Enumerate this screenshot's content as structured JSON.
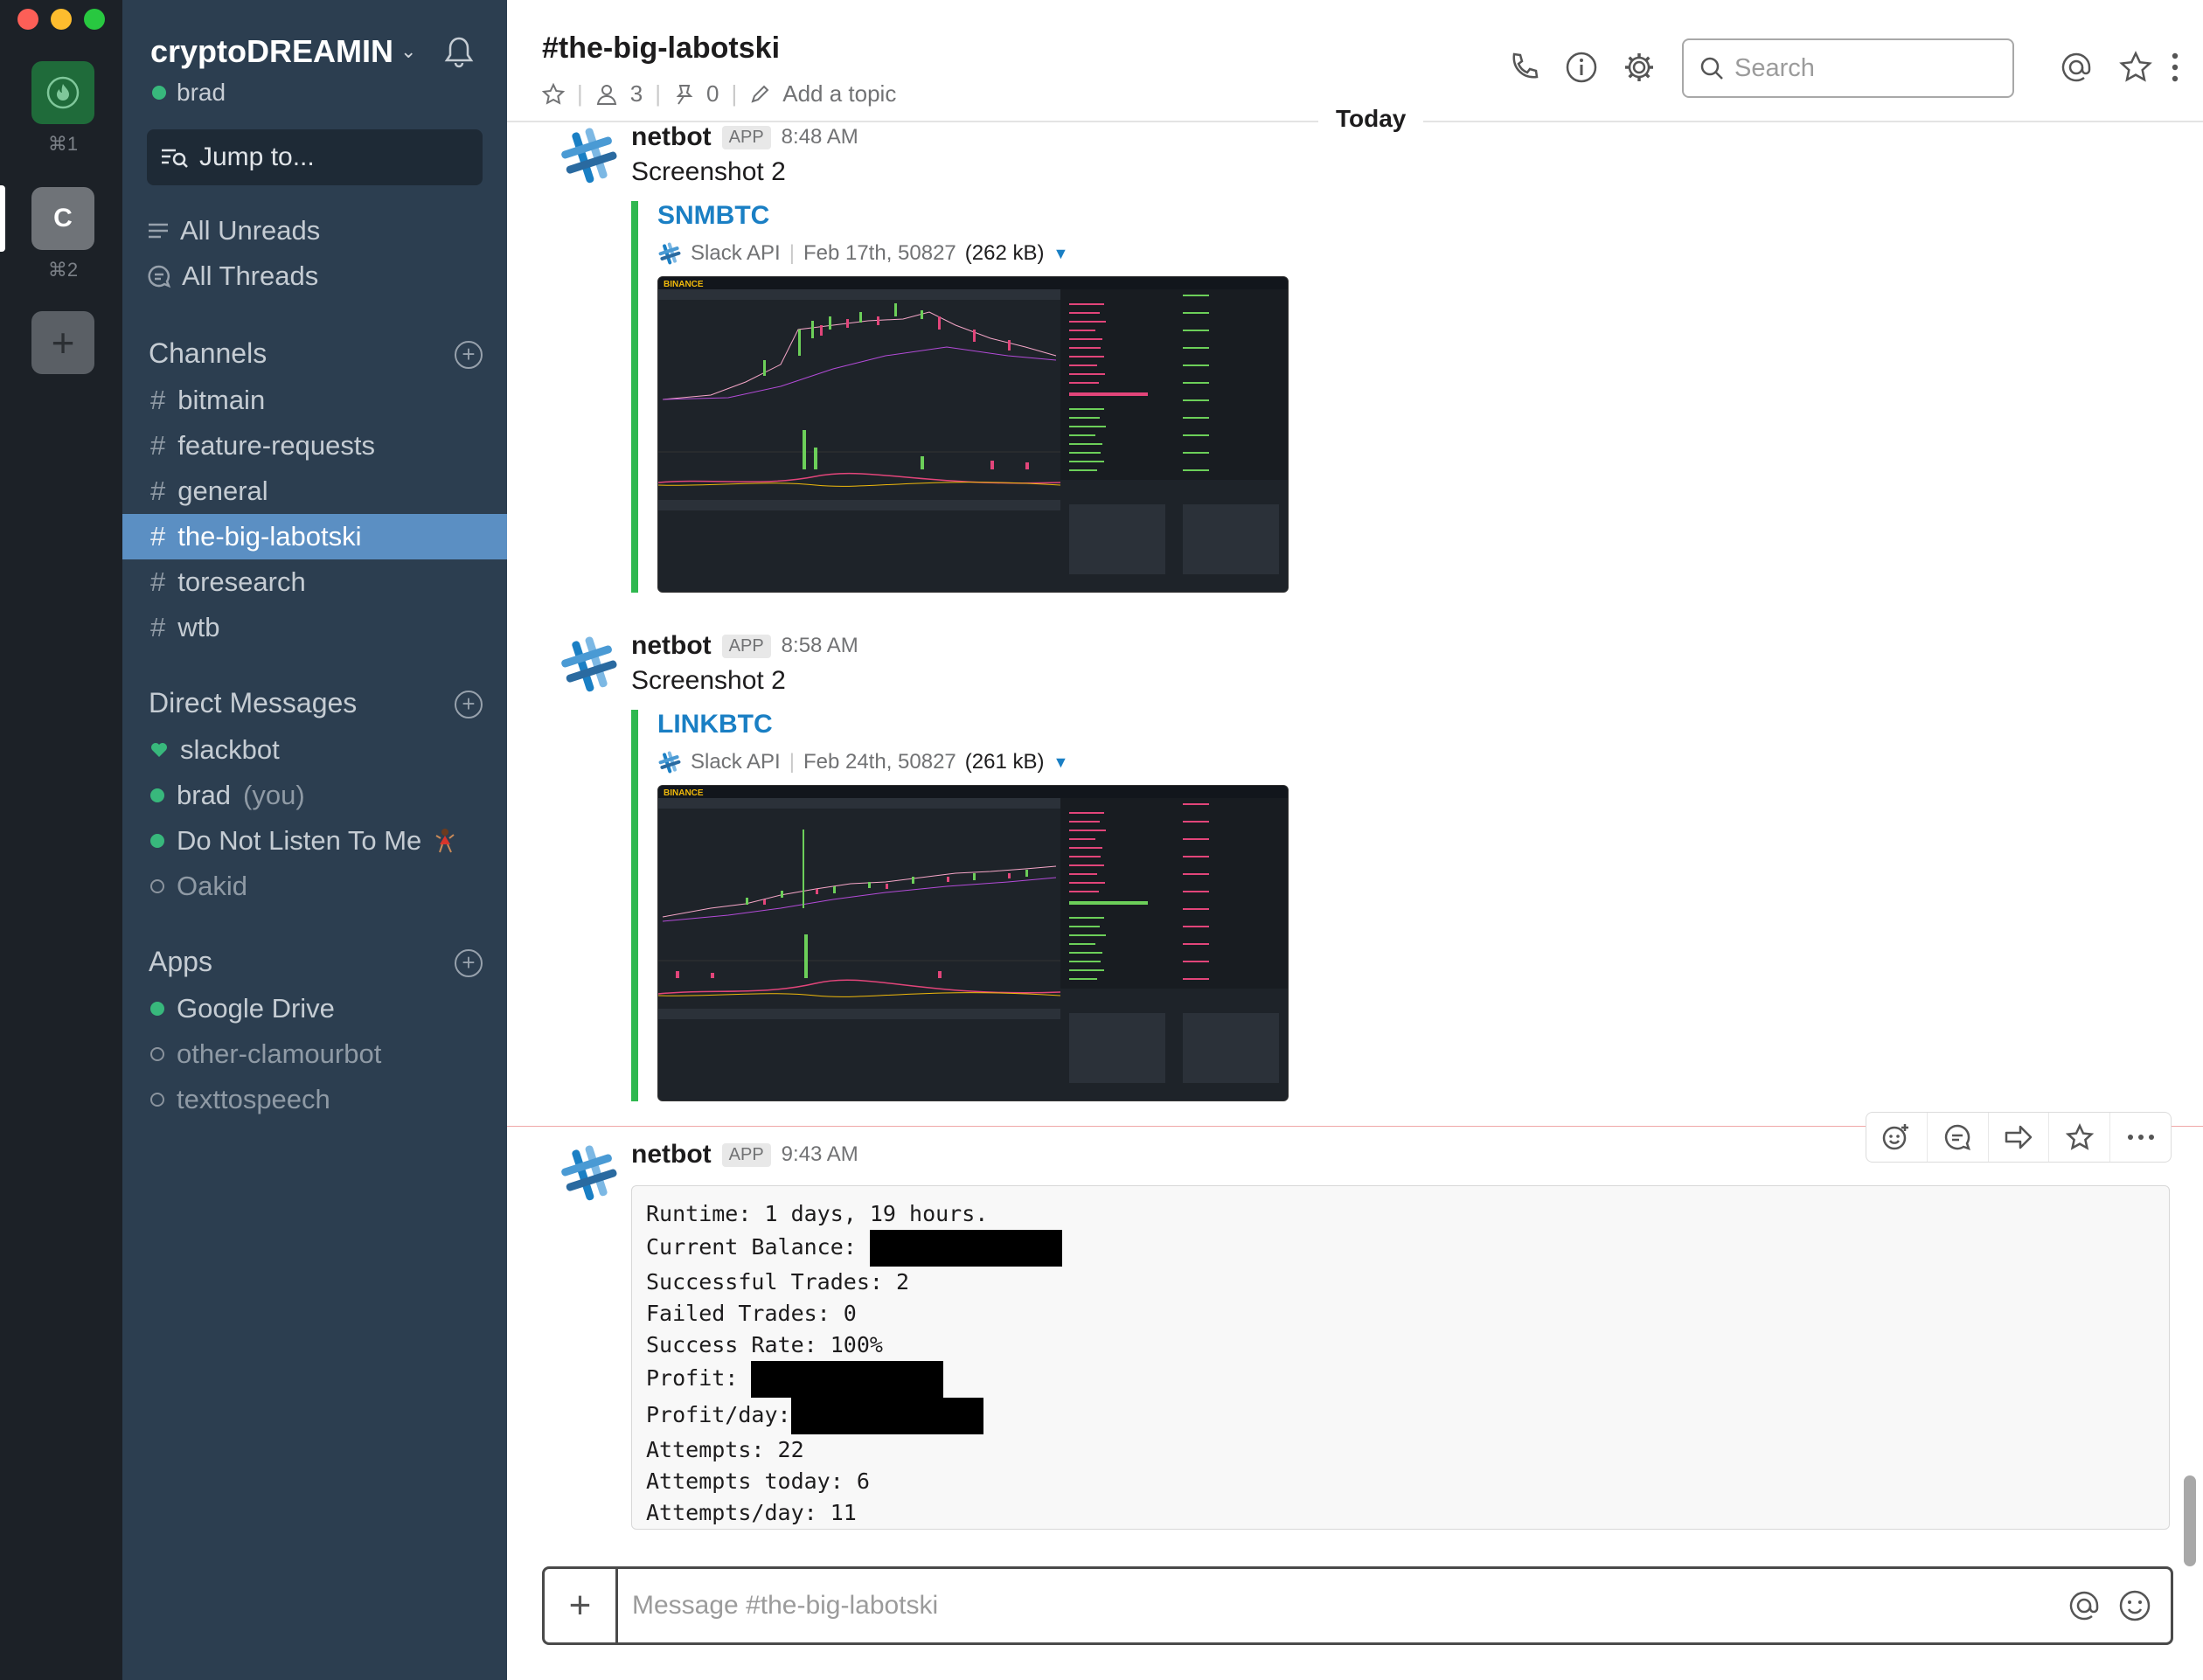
{
  "teams": [
    {
      "initial": "",
      "shortcut": "⌘1"
    },
    {
      "initial": "C",
      "shortcut": "⌘2"
    }
  ],
  "add_team": "+",
  "workspace": {
    "name": "cryptoDREAMIN",
    "caret": "⌄",
    "user": "brad"
  },
  "jump_to": "Jump to...",
  "nav": {
    "all_unreads": "All Unreads",
    "all_threads": "All Threads"
  },
  "channels_section": {
    "title": "Channels",
    "items": [
      {
        "hash": "#",
        "name": "bitmain"
      },
      {
        "hash": "#",
        "name": "feature-requests"
      },
      {
        "hash": "#",
        "name": "general"
      },
      {
        "hash": "#",
        "name": "the-big-labotski"
      },
      {
        "hash": "#",
        "name": "toresearch"
      },
      {
        "hash": "#",
        "name": "wtb"
      }
    ]
  },
  "dm_section": {
    "title": "Direct Messages",
    "items": [
      {
        "name": "slackbot",
        "suffix": ""
      },
      {
        "name": "brad",
        "suffix": "(you)"
      },
      {
        "name": "Do Not Listen To Me",
        "suffix": ""
      },
      {
        "name": "Oakid",
        "suffix": ""
      }
    ]
  },
  "apps_section": {
    "title": "Apps",
    "items": [
      {
        "name": "Google Drive"
      },
      {
        "name": "other-clamourbot"
      },
      {
        "name": "texttospeech"
      }
    ]
  },
  "channel": {
    "title": "#the-big-labotski",
    "members": "3",
    "pins": "0",
    "topic": "Add a topic"
  },
  "search": {
    "placeholder": "Search"
  },
  "day_divider": "Today",
  "messages": [
    {
      "author": "netbot",
      "badge": "APP",
      "time": "8:48 AM",
      "text": "Screenshot 2",
      "attachment": {
        "title": "SNMBTC",
        "source": "Slack API",
        "date": "Feb 17th, 50827",
        "size": "(262 kB)"
      }
    },
    {
      "author": "netbot",
      "badge": "APP",
      "time": "8:58 AM",
      "text": "Screenshot 2",
      "attachment": {
        "title": "LINKBTC",
        "source": "Slack API",
        "date": "Feb 24th, 50827",
        "size": "(261 kB)"
      }
    },
    {
      "author": "netbot",
      "badge": "APP",
      "time": "9:43 AM",
      "code": {
        "runtime": "Runtime: 1 days, 19 hours.",
        "balance_label": "Current Balance:",
        "successful": "Successful Trades: 2",
        "failed": "Failed Trades: 0",
        "rate": "Success Rate: 100%",
        "profit_label": "Profit:",
        "profit_day_label": "Profit/day:",
        "attempts": "Attempts: 22",
        "attempts_today": "Attempts today: 6",
        "attempts_day": "Attempts/day: 11"
      }
    }
  ],
  "screenshot_brand": "BINANCE",
  "composer": {
    "placeholder": "Message #the-big-labotski"
  },
  "colors": {
    "sidebar": "#2c3e50",
    "active_channel": "#5b8fc3",
    "online": "#38b87c",
    "attachment_bar": "#2fb84f",
    "link": "#1a7fc4"
  }
}
